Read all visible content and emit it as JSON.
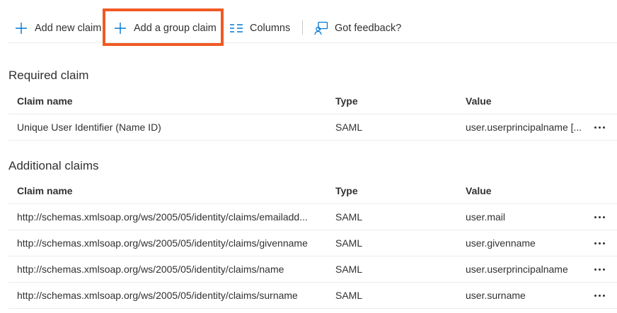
{
  "toolbar": {
    "add_new_claim": "Add new claim",
    "add_group_claim": "Add a group claim",
    "columns": "Columns",
    "feedback": "Got feedback?"
  },
  "colors": {
    "highlight": "#f05a24",
    "icon_blue": "#0078d4"
  },
  "required": {
    "title": "Required claim",
    "headers": {
      "name": "Claim name",
      "type": "Type",
      "value": "Value"
    },
    "rows": [
      {
        "name": "Unique User Identifier (Name ID)",
        "type": "SAML",
        "value": "user.userprincipalname [..."
      }
    ]
  },
  "additional": {
    "title": "Additional claims",
    "headers": {
      "name": "Claim name",
      "type": "Type",
      "value": "Value"
    },
    "rows": [
      {
        "name": "http://schemas.xmlsoap.org/ws/2005/05/identity/claims/emailadd...",
        "type": "SAML",
        "value": "user.mail"
      },
      {
        "name": "http://schemas.xmlsoap.org/ws/2005/05/identity/claims/givenname",
        "type": "SAML",
        "value": "user.givenname"
      },
      {
        "name": "http://schemas.xmlsoap.org/ws/2005/05/identity/claims/name",
        "type": "SAML",
        "value": "user.userprincipalname"
      },
      {
        "name": "http://schemas.xmlsoap.org/ws/2005/05/identity/claims/surname",
        "type": "SAML",
        "value": "user.surname"
      }
    ]
  }
}
